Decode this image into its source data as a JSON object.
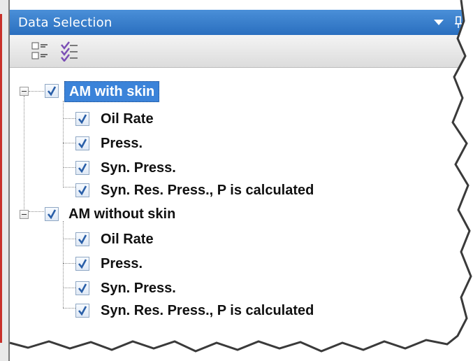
{
  "panel": {
    "title": "Data Selection",
    "dropdown_icon": "chevron-down-icon",
    "pin_icon": "pin-icon"
  },
  "toolbar": {
    "buttons": [
      {
        "icon": "collapse-list-icon"
      },
      {
        "icon": "check-all-icon"
      }
    ]
  },
  "tree": {
    "groups": [
      {
        "label": "AM with skin",
        "checked": true,
        "selected": true,
        "children": [
          {
            "label": "Oil Rate",
            "checked": true
          },
          {
            "label": "Press.",
            "checked": true
          },
          {
            "label": "Syn. Press.",
            "checked": true
          },
          {
            "label": "Syn. Res. Press., P is calculated",
            "checked": true
          }
        ]
      },
      {
        "label": "AM without skin",
        "checked": true,
        "selected": false,
        "children": [
          {
            "label": "Oil Rate",
            "checked": true
          },
          {
            "label": "Press.",
            "checked": true
          },
          {
            "label": "Syn. Press.",
            "checked": true
          },
          {
            "label": "Syn. Res. Press., P is calculated",
            "checked": true
          }
        ]
      }
    ]
  },
  "colors": {
    "title_bar": "#2a6fbf",
    "selection": "#3b83d9",
    "check": "#2a5fa8"
  }
}
